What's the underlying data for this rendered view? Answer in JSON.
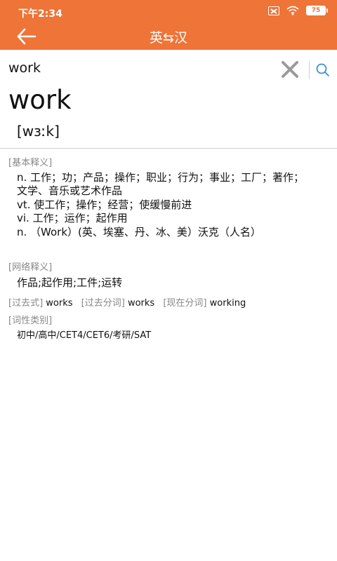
{
  "status_bar": {
    "time": "下午2:34",
    "battery": "75"
  },
  "nav": {
    "title": "英⇆汉"
  },
  "search": {
    "value": "work"
  },
  "entry": {
    "headword": "work",
    "phonetic": "[wɜːk]",
    "basic_label": "[基本释义]",
    "basic_defs": [
      "n. 工作；功；产品；操作；职业；行为；事业；工厂；著作；",
      "文学、音乐或艺术作品",
      "vt. 使工作；操作；经营；使缓慢前进",
      "vi. 工作；运作；起作用",
      "n. （Work）(英、埃塞、丹、冰、美）沃克（人名）"
    ],
    "web_label": "[网络释义]",
    "web_def": "作品;起作用;工件;运转",
    "forms": [
      {
        "label": "[过去式]",
        "value": "works"
      },
      {
        "label": "[过去分词]",
        "value": "works"
      },
      {
        "label": "[现在分词]",
        "value": "working"
      }
    ],
    "level_label": "[词性类别]",
    "levels": "初中/高中/CET4/CET6/考研/SAT"
  },
  "icons": {
    "back": "arrow-left-icon",
    "clear": "close-icon",
    "search": "search-icon",
    "wifi": "wifi-icon",
    "sim": "no-sim-icon",
    "battery": "battery-icon"
  },
  "colors": {
    "accent": "#ee7437",
    "label_gray": "#888888",
    "divider": "#cfcfcf"
  }
}
